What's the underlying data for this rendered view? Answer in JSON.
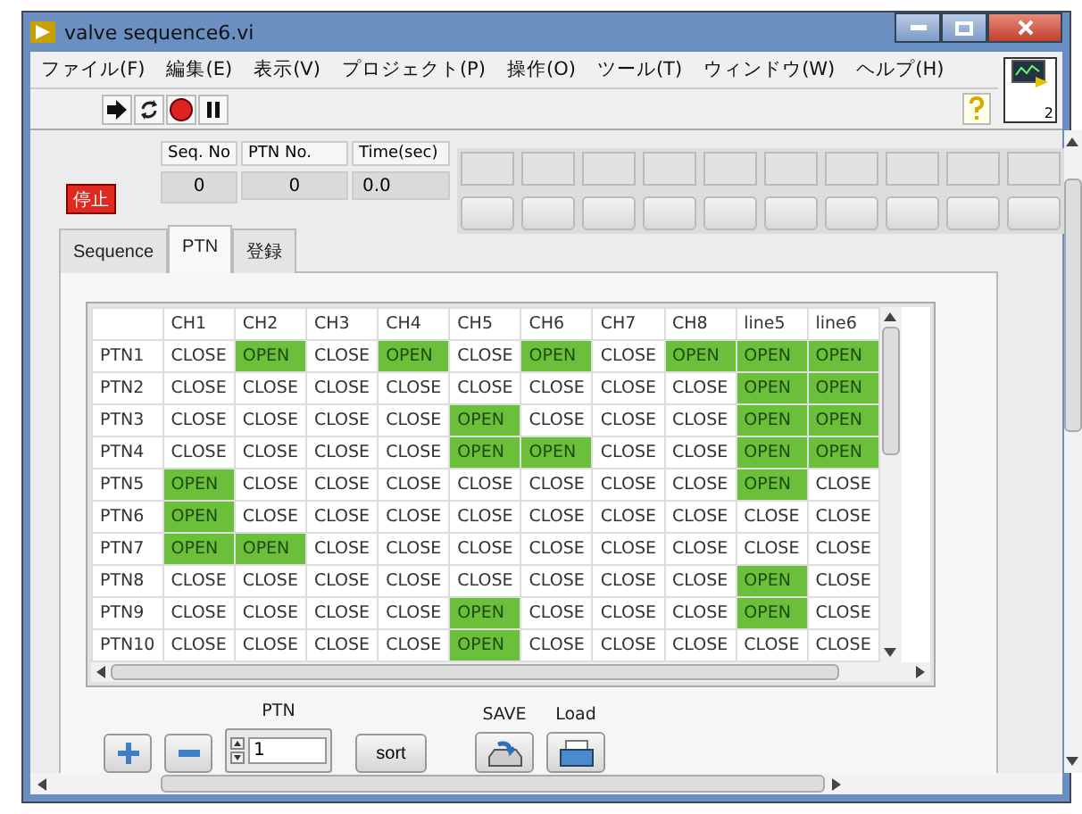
{
  "window": {
    "title": "valve sequence6.vi"
  },
  "menu": [
    "ファイル(F)",
    "編集(E)",
    "表示(V)",
    "プロジェクト(P)",
    "操作(O)",
    "ツール(T)",
    "ウィンドウ(W)",
    "ヘルプ(H)"
  ],
  "connector_pane": {
    "label": "2"
  },
  "stop_button": {
    "label": "停止"
  },
  "indicators": [
    {
      "label": "Seq. No",
      "value": "0"
    },
    {
      "label": "PTN No.",
      "value": "0"
    },
    {
      "label": "Time(sec)",
      "value": "0.0"
    }
  ],
  "tabs": [
    {
      "label": "Sequence",
      "selected": false
    },
    {
      "label": "PTN",
      "selected": true
    },
    {
      "label": "登録",
      "selected": false
    }
  ],
  "table": {
    "columns": [
      "CH1",
      "CH2",
      "CH3",
      "CH4",
      "CH5",
      "CH6",
      "CH7",
      "CH8",
      "line5",
      "line6"
    ],
    "rows": [
      {
        "name": "PTN1",
        "cells": [
          {
            "text": "CLOSE",
            "on": false
          },
          {
            "text": "OPEN",
            "on": true
          },
          {
            "text": "CLOSE",
            "on": false
          },
          {
            "text": "OPEN",
            "on": true
          },
          {
            "text": "CLOSE",
            "on": false
          },
          {
            "text": "OPEN",
            "on": true
          },
          {
            "text": "CLOSE",
            "on": false
          },
          {
            "text": "OPEN",
            "on": true
          },
          {
            "text": "OPEN",
            "on": true
          },
          {
            "text": "OPEN",
            "on": true
          }
        ]
      },
      {
        "name": "PTN2",
        "cells": [
          {
            "text": "CLOSE",
            "on": false
          },
          {
            "text": "CLOSE",
            "on": false
          },
          {
            "text": "CLOSE",
            "on": false
          },
          {
            "text": "CLOSE",
            "on": false
          },
          {
            "text": "CLOSE",
            "on": false
          },
          {
            "text": "CLOSE",
            "on": false
          },
          {
            "text": "CLOSE",
            "on": false
          },
          {
            "text": "CLOSE",
            "on": false
          },
          {
            "text": "OPEN",
            "on": true
          },
          {
            "text": "OPEN",
            "on": true
          }
        ]
      },
      {
        "name": "PTN3",
        "cells": [
          {
            "text": "CLOSE",
            "on": false
          },
          {
            "text": "CLOSE",
            "on": false
          },
          {
            "text": "CLOSE",
            "on": false
          },
          {
            "text": "CLOSE",
            "on": false
          },
          {
            "text": "OPEN",
            "on": true
          },
          {
            "text": "CLOSE",
            "on": false
          },
          {
            "text": "CLOSE",
            "on": false
          },
          {
            "text": "CLOSE",
            "on": false
          },
          {
            "text": "OPEN",
            "on": true
          },
          {
            "text": "OPEN",
            "on": true
          }
        ]
      },
      {
        "name": "PTN4",
        "cells": [
          {
            "text": "CLOSE",
            "on": false
          },
          {
            "text": "CLOSE",
            "on": false
          },
          {
            "text": "CLOSE",
            "on": false
          },
          {
            "text": "CLOSE",
            "on": false
          },
          {
            "text": "OPEN",
            "on": true
          },
          {
            "text": "OPEN",
            "on": true
          },
          {
            "text": "CLOSE",
            "on": false
          },
          {
            "text": "CLOSE",
            "on": false
          },
          {
            "text": "OPEN",
            "on": true
          },
          {
            "text": "OPEN",
            "on": true
          }
        ]
      },
      {
        "name": "PTN5",
        "cells": [
          {
            "text": "OPEN",
            "on": true
          },
          {
            "text": "CLOSE",
            "on": false
          },
          {
            "text": "CLOSE",
            "on": false
          },
          {
            "text": "CLOSE",
            "on": false
          },
          {
            "text": "CLOSE",
            "on": false
          },
          {
            "text": "CLOSE",
            "on": false
          },
          {
            "text": "CLOSE",
            "on": false
          },
          {
            "text": "CLOSE",
            "on": false
          },
          {
            "text": "OPEN",
            "on": true
          },
          {
            "text": "CLOSE",
            "on": false
          }
        ]
      },
      {
        "name": "PTN6",
        "cells": [
          {
            "text": "OPEN",
            "on": true
          },
          {
            "text": "CLOSE",
            "on": false
          },
          {
            "text": "CLOSE",
            "on": false
          },
          {
            "text": "CLOSE",
            "on": false
          },
          {
            "text": "CLOSE",
            "on": false
          },
          {
            "text": "CLOSE",
            "on": false
          },
          {
            "text": "CLOSE",
            "on": false
          },
          {
            "text": "CLOSE",
            "on": false
          },
          {
            "text": "CLOSE",
            "on": false
          },
          {
            "text": "CLOSE",
            "on": false
          }
        ]
      },
      {
        "name": "PTN7",
        "cells": [
          {
            "text": "OPEN",
            "on": true
          },
          {
            "text": "OPEN",
            "on": true
          },
          {
            "text": "CLOSE",
            "on": false
          },
          {
            "text": "CLOSE",
            "on": false
          },
          {
            "text": "CLOSE",
            "on": false
          },
          {
            "text": "CLOSE",
            "on": false
          },
          {
            "text": "CLOSE",
            "on": false
          },
          {
            "text": "CLOSE",
            "on": false
          },
          {
            "text": "CLOSE",
            "on": false
          },
          {
            "text": "CLOSE",
            "on": false
          }
        ]
      },
      {
        "name": "PTN8",
        "cells": [
          {
            "text": "CLOSE",
            "on": false
          },
          {
            "text": "CLOSE",
            "on": false
          },
          {
            "text": "CLOSE",
            "on": false
          },
          {
            "text": "CLOSE",
            "on": false
          },
          {
            "text": "CLOSE",
            "on": false
          },
          {
            "text": "CLOSE",
            "on": false
          },
          {
            "text": "CLOSE",
            "on": false
          },
          {
            "text": "CLOSE",
            "on": false
          },
          {
            "text": "OPEN",
            "on": true
          },
          {
            "text": "CLOSE",
            "on": false
          }
        ]
      },
      {
        "name": "PTN9",
        "cells": [
          {
            "text": "CLOSE",
            "on": false
          },
          {
            "text": "CLOSE",
            "on": false
          },
          {
            "text": "CLOSE",
            "on": false
          },
          {
            "text": "CLOSE",
            "on": false
          },
          {
            "text": "OPEN",
            "on": true
          },
          {
            "text": "CLOSE",
            "on": false
          },
          {
            "text": "CLOSE",
            "on": false
          },
          {
            "text": "CLOSE",
            "on": false
          },
          {
            "text": "OPEN",
            "on": true
          },
          {
            "text": "CLOSE",
            "on": false
          }
        ]
      },
      {
        "name": "PTN10",
        "cells": [
          {
            "text": "CLOSE",
            "on": false
          },
          {
            "text": "CLOSE",
            "on": false
          },
          {
            "text": "CLOSE",
            "on": false
          },
          {
            "text": "CLOSE",
            "on": false
          },
          {
            "text": "OPEN",
            "on": true
          },
          {
            "text": "CLOSE",
            "on": false
          },
          {
            "text": "CLOSE",
            "on": false
          },
          {
            "text": "CLOSE",
            "on": false
          },
          {
            "text": "CLOSE",
            "on": false
          },
          {
            "text": "CLOSE",
            "on": false
          }
        ]
      }
    ]
  },
  "ptn_control": {
    "label": "PTN",
    "value": "1"
  },
  "sort_button": {
    "label": "sort"
  },
  "save": {
    "label": "SAVE"
  },
  "load": {
    "label": "Load"
  }
}
